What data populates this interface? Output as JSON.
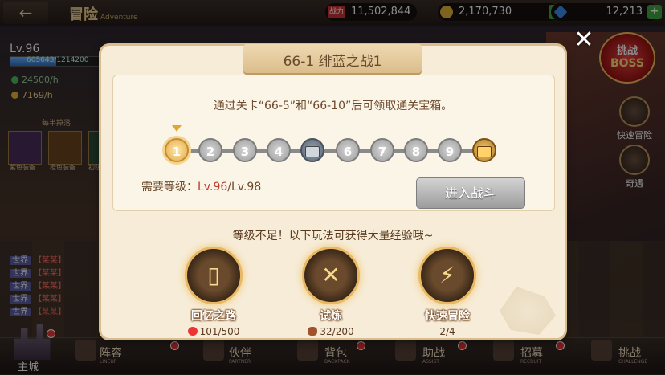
{
  "topbar": {
    "back_icon": "←",
    "title": "冒险",
    "title_en": "Adventure",
    "power_label": "战力",
    "power": "11,502,844",
    "gold": "2,170,730",
    "gems": "12,213",
    "add_icon": "+"
  },
  "player": {
    "level": "Lv.96",
    "exp": "605643/1214200",
    "exp_fraction": 0.4988,
    "rate_a": "24500/h",
    "rate_b": "7169/h"
  },
  "drops": {
    "title": "每半掉落",
    "items": [
      "紫色装备",
      "橙色装备",
      "初级"
    ]
  },
  "chat": [
    {
      "tag": "世界",
      "name": "【某某】"
    },
    {
      "tag": "世界",
      "name": "【某某】"
    },
    {
      "tag": "世界",
      "name": "【某某】"
    },
    {
      "tag": "世界",
      "name": "【某某】"
    },
    {
      "tag": "世界",
      "name": "【某某】"
    }
  ],
  "right": {
    "close": "✕",
    "boss_l1": "挑战",
    "boss_l2": "BOSS",
    "quick": "快速冒险",
    "event": "奇遇"
  },
  "dialog": {
    "title": "66-1 绯蓝之战1",
    "description": "通过关卡“66-5”和“66-10”后可领取通关宝箱。",
    "stages": [
      "1",
      "2",
      "3",
      "4",
      "chest",
      "6",
      "7",
      "8",
      "9",
      "gold-chest"
    ],
    "required_label": "需要等级：",
    "current_level": "Lv.96",
    "required_level": "/Lv.98",
    "enter_button": "进入战斗",
    "hint": "等级不足！以下玩法可获得大量经验哦~",
    "options": [
      {
        "name": "回忆之路",
        "count": "101/500",
        "icon": "cards-icon"
      },
      {
        "name": "试炼",
        "count": "32/200",
        "icon": "crossed-swords-icon"
      },
      {
        "name": "快速冒险",
        "count": "2/4",
        "icon": "broken-sword-icon"
      }
    ]
  },
  "nav": {
    "home": "主城",
    "items": [
      {
        "label": "阵容",
        "en": "LINEUP"
      },
      {
        "label": "伙伴",
        "en": "PARTNER"
      },
      {
        "label": "背包",
        "en": "BACKPACK"
      },
      {
        "label": "助战",
        "en": "ASSIST"
      },
      {
        "label": "招募",
        "en": "RECRUIT"
      },
      {
        "label": "挑战",
        "en": "CHALLENGE"
      }
    ]
  },
  "colors": {
    "accent": "#e8b864",
    "text_brown": "#6e4a2c",
    "danger": "#c0392b"
  }
}
